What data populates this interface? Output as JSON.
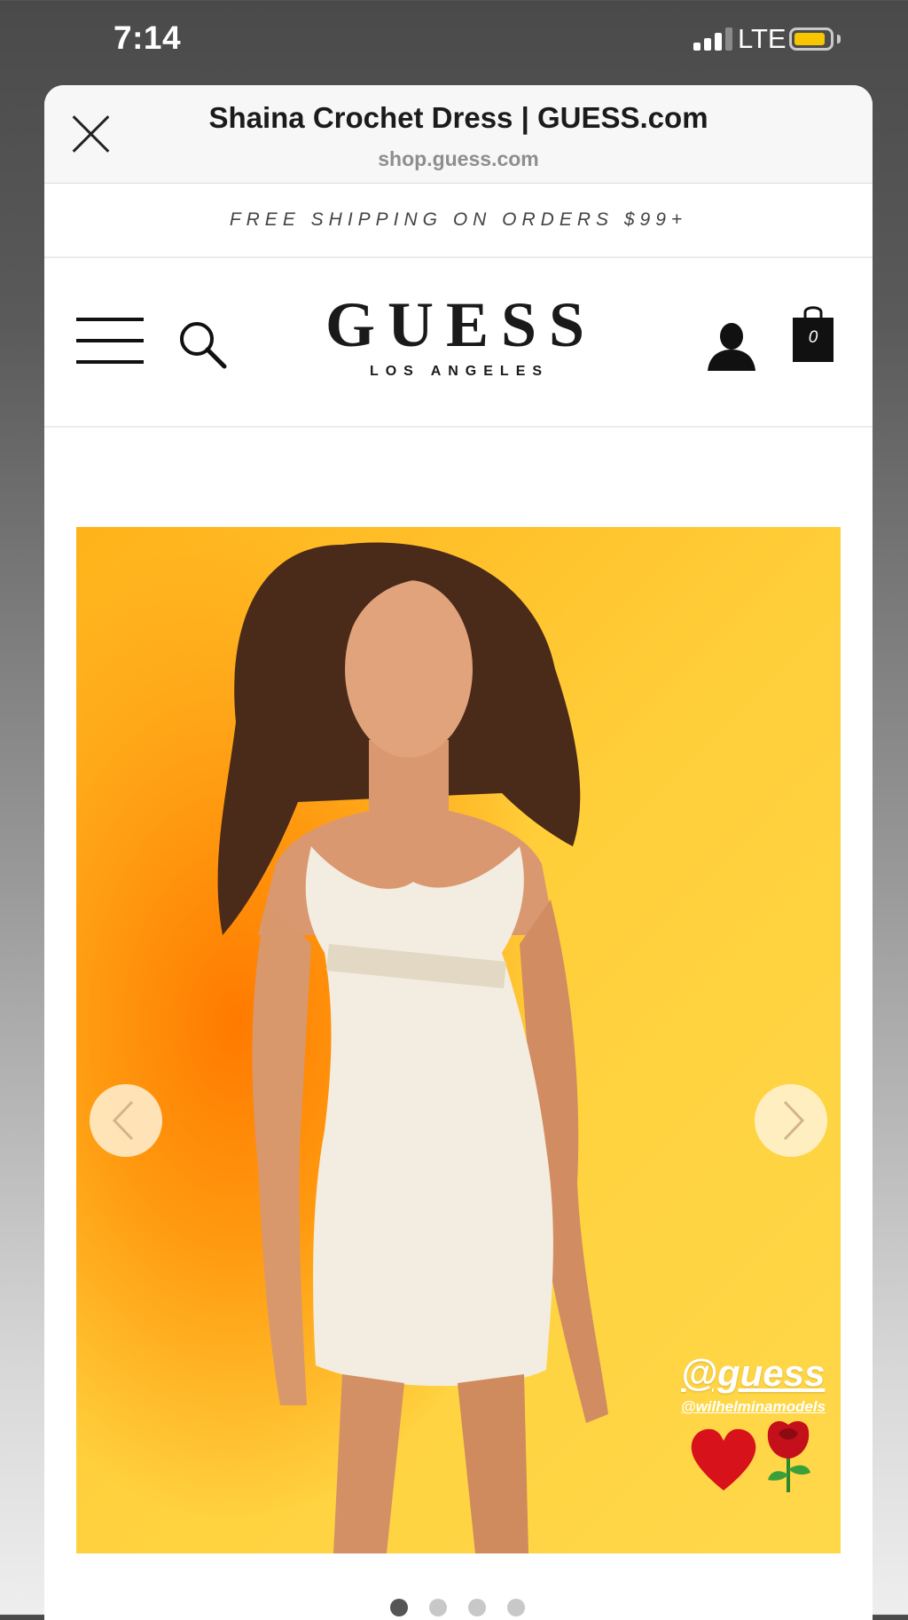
{
  "status_bar": {
    "time": "7:14",
    "network": "LTE",
    "battery_color": "#f7c600"
  },
  "sheet_header": {
    "title": "Shaina Crochet Dress | GUESS.com",
    "domain": "shop.guess.com",
    "close_icon": "close-icon"
  },
  "promo": {
    "text": "FREE SHIPPING ON ORDERS $99+"
  },
  "site_header": {
    "logo_main": "GUESS",
    "logo_sub": "LOS ANGELES",
    "menu_icon": "hamburger-menu-icon",
    "search_icon": "search-icon",
    "account_icon": "account-icon",
    "cart_icon": "shopping-bag-icon",
    "cart_count": "0"
  },
  "product_image": {
    "description_icon": "product-photo",
    "background_colors": [
      "#ff7a00",
      "#ffc928"
    ],
    "tag_handle": "@guess",
    "tag_agency": "@wilhelminamodels",
    "stickers": [
      "heart-icon",
      "rose-icon"
    ]
  },
  "carousel": {
    "total": 4,
    "active_index": 0
  }
}
